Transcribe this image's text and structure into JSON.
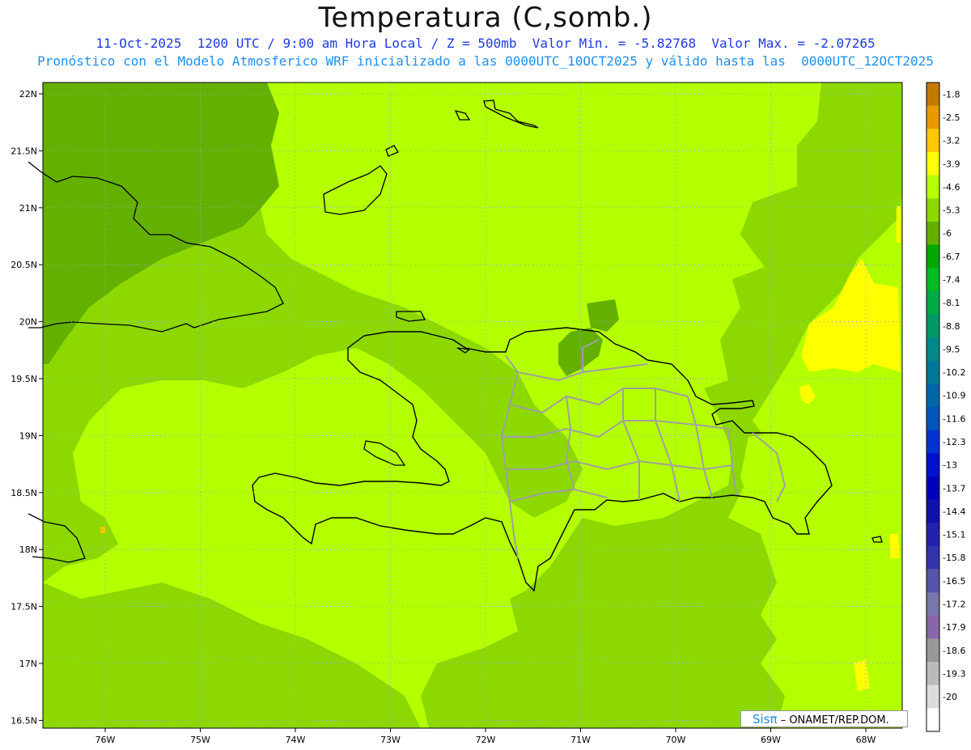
{
  "header": {
    "title": "Temperatura (C,somb.)",
    "line1": "11-Oct-2025  1200 UTC / 9:00 am Hora Local / Z = 500mb  Valor Min. = -5.82768  Valor Max. = -2.07265",
    "line2": "Pronóstico con el Modelo Atmosferico WRF inicializado a las 0000UTC_10OCT2025 y válido hasta las  0000UTC_12OCT2025"
  },
  "map": {
    "lat_labels": [
      "22N",
      "21.5N",
      "21N",
      "20.5N",
      "20N",
      "19.5N",
      "19N",
      "18.5N",
      "18N",
      "17.5N",
      "17N",
      "16.5N"
    ],
    "lon_labels": [
      "76W",
      "75W",
      "74W",
      "73W",
      "72W",
      "71W",
      "70W",
      "69W",
      "68W"
    ]
  },
  "colorbar": {
    "labels": [
      "-1.8",
      "-2.5",
      "-3.2",
      "-3.9",
      "-4.6",
      "-5.3",
      "-6",
      "-6.7",
      "-7.4",
      "-8.1",
      "-8.8",
      "-9.5",
      "-10.2",
      "-10.9",
      "-11.6",
      "-12.3",
      "-13",
      "-13.7",
      "-14.4",
      "-15.1",
      "-15.8",
      "-16.5",
      "-17.2",
      "-17.9",
      "-18.6",
      "-19.3",
      "-20"
    ],
    "colors": [
      "#c47a00",
      "#e89a00",
      "#ffc800",
      "#ffff00",
      "#b4ff00",
      "#8cd800",
      "#64b000",
      "#00a800",
      "#00bb22",
      "#00aa44",
      "#009966",
      "#008888",
      "#007799",
      "#0066aa",
      "#0055bb",
      "#0033cc",
      "#0011cc",
      "#0000bb",
      "#1111aa",
      "#2222aa",
      "#3333aa",
      "#5555aa",
      "#7777aa",
      "#8866aa",
      "#999999",
      "#bbbbbb",
      "#dddddd",
      "#ffffff"
    ]
  },
  "logo": {
    "brand": "Sisπ",
    "text": "– ONAMET/REP.DOM."
  },
  "colors": {
    "light": "#b4ff00",
    "mid": "#8cd800",
    "dark": "#64b000",
    "yellow": "#ffff00",
    "coast": "#000000",
    "provinces": "#a0a0a0"
  }
}
